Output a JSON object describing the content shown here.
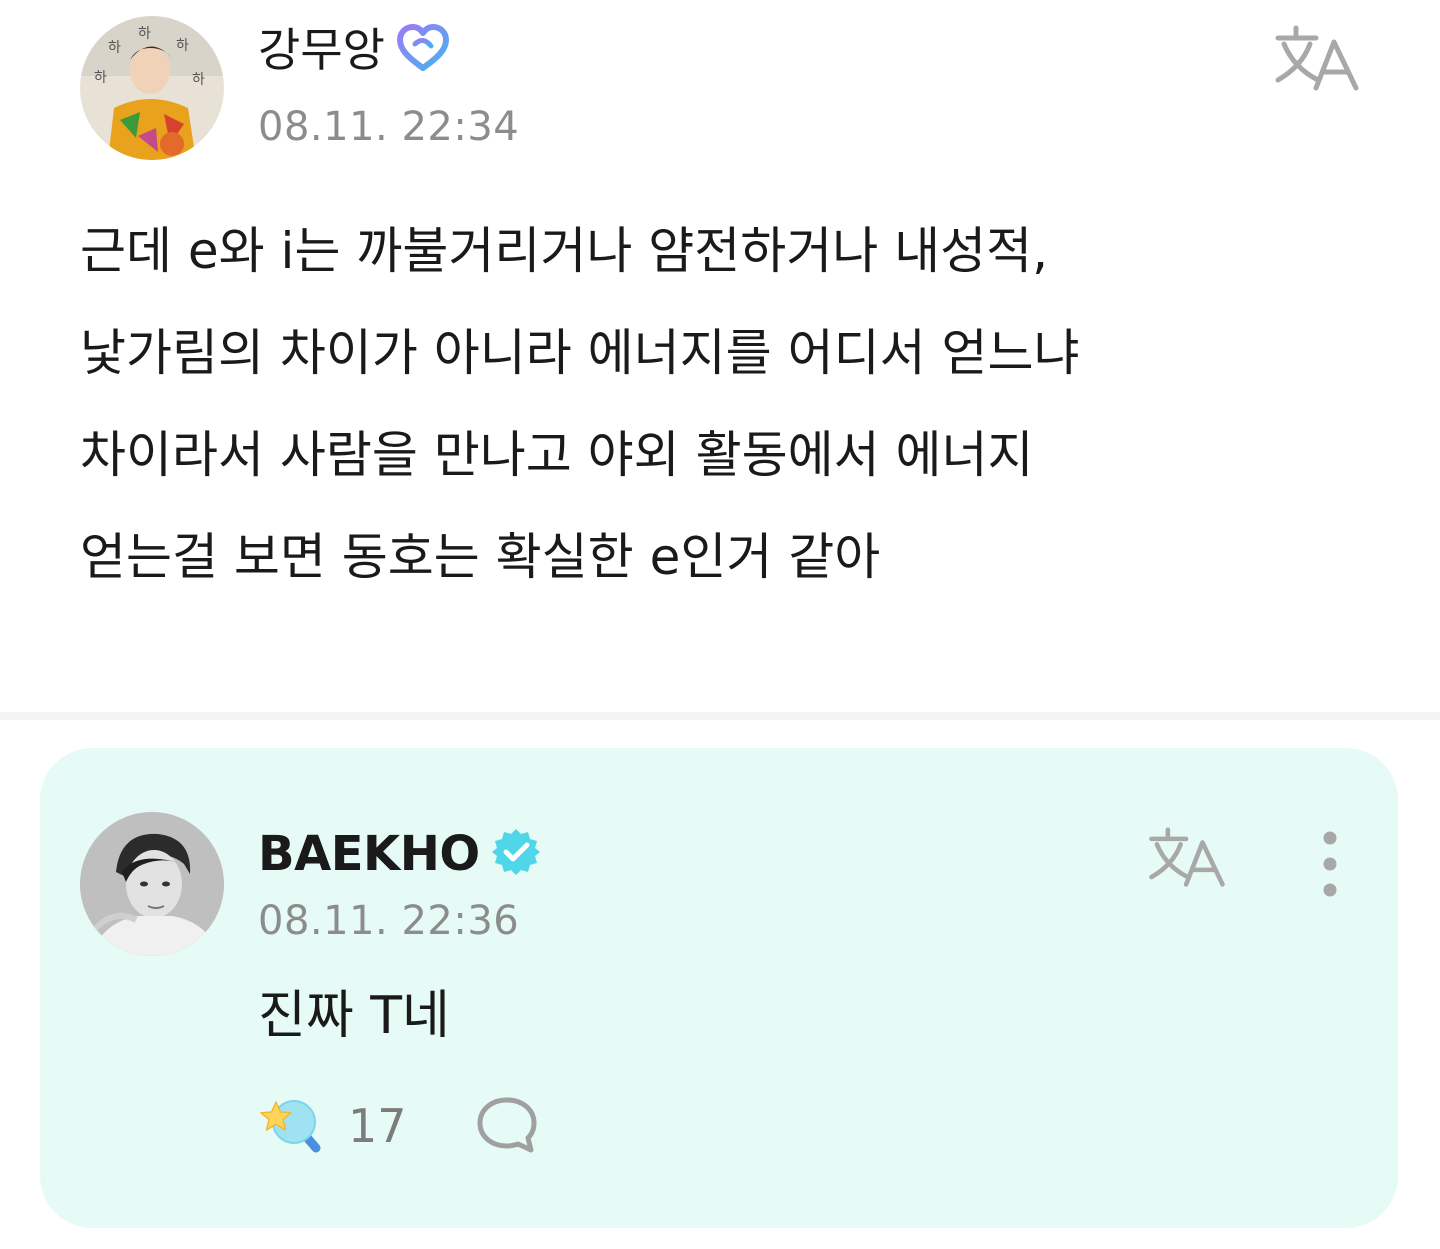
{
  "post": {
    "author": {
      "name": "강무앙",
      "badge_icon": "artist-heart-badge-icon"
    },
    "timestamp": "08.11. 22:34",
    "translate_icon": "translate-icon",
    "body_lines": [
      "근데 e와 i는 까불거리거나 얌전하거나 내성적,",
      "낯가림의 차이가 아니라 에너지를 어디서 얻느냐",
      "차이라서 사람을 만나고 야외 활동에서 에너지",
      "얻는걸 보면 동호는 확실한 e인거 같아"
    ]
  },
  "comment": {
    "author": {
      "name": "BAEKHO",
      "badge_icon": "verified-badge-icon"
    },
    "timestamp": "08.11. 22:36",
    "text": "진짜 T네",
    "like_count": "17",
    "translate_icon": "translate-icon",
    "more_icon": "more-vertical-icon",
    "like_icon": "star-lightstick-icon",
    "reply_icon": "speech-bubble-icon"
  },
  "colors": {
    "card_background": "#e6fbf6",
    "timestamp": "#8c8c8c",
    "verified_badge": "#4fd6e8",
    "artist_badge_gradient": [
      "#7b7cf7",
      "#4fb6f0"
    ],
    "divider": "#f3f3f3"
  }
}
